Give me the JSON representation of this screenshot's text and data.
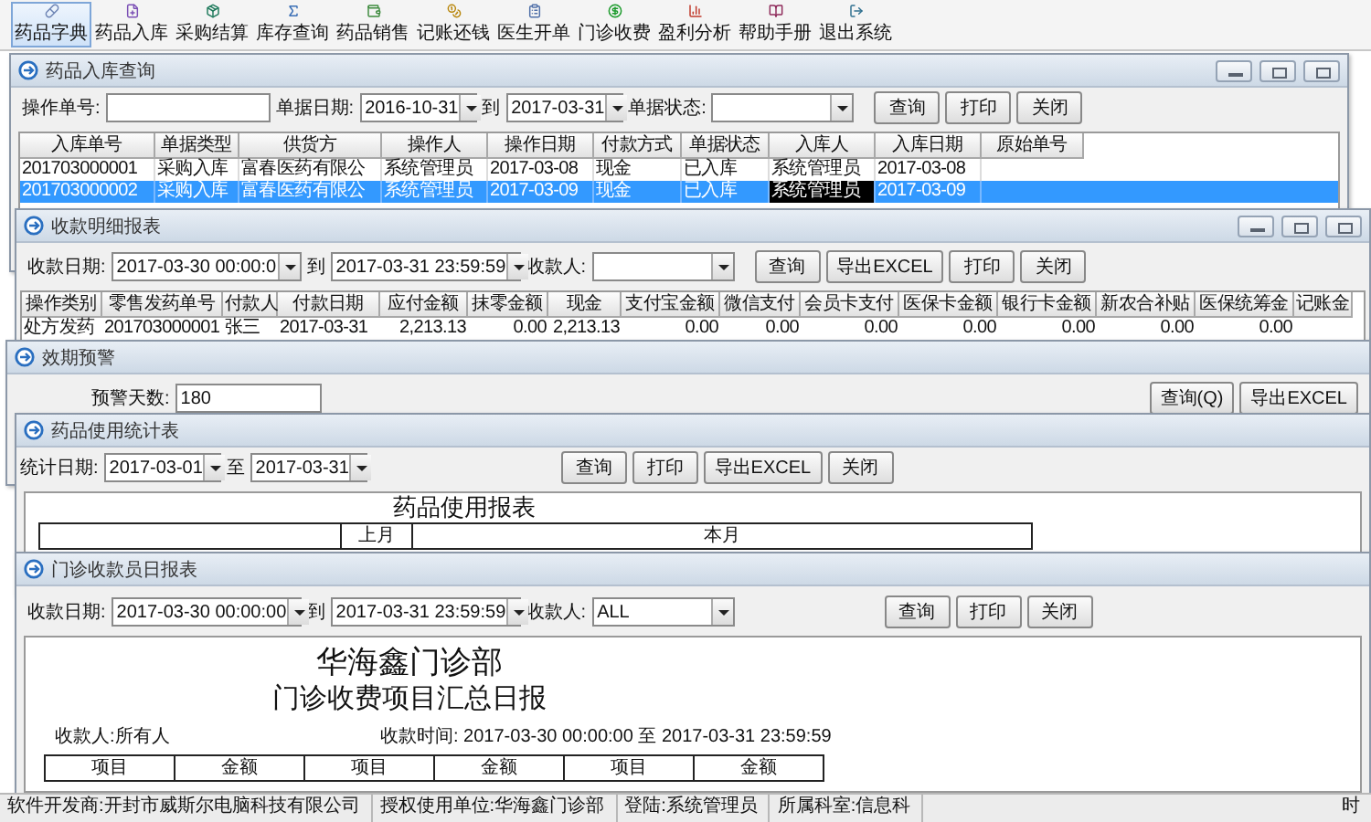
{
  "toolbar": [
    {
      "label": "药品字典",
      "selected": true
    },
    {
      "label": "药品入库",
      "selected": false
    },
    {
      "label": "采购结算",
      "selected": false
    },
    {
      "label": "库存查询",
      "selected": false
    },
    {
      "label": "药品销售",
      "selected": false
    },
    {
      "label": "记账还钱",
      "selected": false
    },
    {
      "label": "医生开单",
      "selected": false
    },
    {
      "label": "门诊收费",
      "selected": false
    },
    {
      "label": "盈利分析",
      "selected": false
    },
    {
      "label": "帮助手册",
      "selected": false
    },
    {
      "label": "退出系统",
      "selected": false
    }
  ],
  "windows": [
    {
      "title": "药品入库查询",
      "caption_buttons": true,
      "controls": [
        {
          "kind": "label",
          "text": "操作单号:"
        },
        {
          "kind": "field"
        },
        {
          "kind": "label",
          "text": "单据日期:"
        },
        {
          "kind": "date",
          "value": "2016-10-31"
        },
        {
          "kind": "label",
          "text": "到"
        },
        {
          "kind": "date",
          "value": "2017-03-31"
        },
        {
          "kind": "label",
          "text": "单据状态:"
        },
        {
          "kind": "combo"
        },
        {
          "kind": "button",
          "text": "查询"
        },
        {
          "kind": "button",
          "text": "打印"
        },
        {
          "kind": "button",
          "text": "关闭"
        }
      ],
      "table": {
        "columns": [
          "入库单号",
          "单据类型",
          "供货方",
          "操作人",
          "操作日期",
          "付款方式",
          "单据状态",
          "入库人",
          "入库日期",
          "原始单号"
        ],
        "rows": [
          {
            "selected": false,
            "cells": [
              {
                "text": "201703000001",
                "focused": false
              },
              {
                "text": "采购入库",
                "focused": false
              },
              {
                "text": "富春医药有限公",
                "focused": false
              },
              {
                "text": "系统管理员",
                "focused": false
              },
              {
                "text": "2017-03-08",
                "focused": false
              },
              {
                "text": "现金",
                "focused": false
              },
              {
                "text": "已入库",
                "focused": false
              },
              {
                "text": "系统管理员",
                "focused": false
              },
              {
                "text": "2017-03-08",
                "focused": false
              }
            ]
          },
          {
            "selected": true,
            "cells": [
              {
                "text": "201703000002",
                "focused": false
              },
              {
                "text": "采购入库",
                "focused": false
              },
              {
                "text": "富春医药有限公",
                "focused": false
              },
              {
                "text": "系统管理员",
                "focused": false
              },
              {
                "text": "2017-03-09",
                "focused": false
              },
              {
                "text": "现金",
                "focused": false
              },
              {
                "text": "已入库",
                "focused": false
              },
              {
                "text": "系统管理员",
                "focused": true
              },
              {
                "text": "2017-03-09",
                "focused": false
              }
            ]
          }
        ]
      }
    },
    {
      "title": "收款明细报表",
      "caption_buttons": true,
      "controls": [
        {
          "kind": "label",
          "text": "收款日期:"
        },
        {
          "kind": "date",
          "value": "2017-03-30 00:00:0"
        },
        {
          "kind": "label",
          "text": "到"
        },
        {
          "kind": "date",
          "value": "2017-03-31 23:59:59"
        },
        {
          "kind": "label",
          "text": "收款人:"
        },
        {
          "kind": "combo"
        },
        {
          "kind": "button",
          "text": "查询"
        },
        {
          "kind": "button",
          "text": "导出EXCEL"
        },
        {
          "kind": "button",
          "text": "打印"
        },
        {
          "kind": "button",
          "text": "关闭"
        }
      ],
      "table": {
        "columns": [
          "操作类别",
          "零售发药单号",
          "付款人",
          "付款日期",
          "应付金额",
          "抹零金额",
          "现金",
          "支付宝金额",
          "微信支付",
          "会员卡支付",
          "医保卡金额",
          "银行卡金额",
          "新农合补贴",
          "医保统筹金",
          "记账金"
        ],
        "rows": [
          {
            "selected": false,
            "cells": [
              {
                "text": "处方发药",
                "focused": false
              },
              {
                "text": "201703000001",
                "focused": false
              },
              {
                "text": "张三",
                "focused": false
              },
              {
                "text": "2017-03-31",
                "focused": false
              },
              {
                "text": "2,213.13",
                "focused": false
              },
              {
                "text": "0.00",
                "focused": false
              },
              {
                "text": "2,213.13",
                "focused": false
              },
              {
                "text": "0.00",
                "focused": false
              },
              {
                "text": "0.00",
                "focused": false
              },
              {
                "text": "0.00",
                "focused": false
              },
              {
                "text": "0.00",
                "focused": false
              },
              {
                "text": "0.00",
                "focused": false
              },
              {
                "text": "0.00",
                "focused": false
              },
              {
                "text": "0.00",
                "focused": false
              }
            ]
          }
        ]
      }
    },
    {
      "title": "效期预警",
      "caption_buttons": false,
      "controls": [
        {
          "kind": "label",
          "text": "预警天数:"
        },
        {
          "kind": "field",
          "value": "180"
        },
        {
          "kind": "button",
          "text": "查询(Q)"
        },
        {
          "kind": "button",
          "text": "导出EXCEL"
        }
      ]
    },
    {
      "title": "药品使用统计表",
      "caption_buttons": false,
      "controls": [
        {
          "kind": "label",
          "text": "统计日期:"
        },
        {
          "kind": "date",
          "value": "2017-03-01"
        },
        {
          "kind": "label",
          "text": "至"
        },
        {
          "kind": "date",
          "value": "2017-03-31"
        },
        {
          "kind": "button",
          "text": "查询"
        },
        {
          "kind": "button",
          "text": "打印"
        },
        {
          "kind": "button",
          "text": "导出EXCEL"
        },
        {
          "kind": "button",
          "text": "关闭"
        }
      ],
      "report": {
        "kind": "usage",
        "title": "药品使用报表",
        "header_cells": [
          "上月",
          "本月"
        ]
      }
    },
    {
      "title": "门诊收款员日报表",
      "caption_buttons": false,
      "controls": [
        {
          "kind": "label",
          "text": "收款日期:"
        },
        {
          "kind": "date",
          "value": "2017-03-30 00:00:00"
        },
        {
          "kind": "label",
          "text": "到"
        },
        {
          "kind": "date",
          "value": "2017-03-31 23:59:59"
        },
        {
          "kind": "label",
          "text": "收款人:"
        },
        {
          "kind": "combo",
          "value": "ALL"
        },
        {
          "kind": "button",
          "text": "查询"
        },
        {
          "kind": "button",
          "text": "打印"
        },
        {
          "kind": "button",
          "text": "关闭"
        }
      ],
      "report": {
        "kind": "daily",
        "title": "华海鑫门诊部",
        "subtitle": "门诊收费项目汇总日报",
        "info_left": "收款人:所有人",
        "info_right": "收款时间: 2017-03-30 00:00:00 至 2017-03-31 23:59:59",
        "header_cells": [
          "项目",
          "金额",
          "项目",
          "金额",
          "项目",
          "金额"
        ]
      }
    }
  ],
  "status_bar": [
    "软件开发商:开封市威斯尔电脑科技有限公司",
    "授权使用单位:华海鑫门诊部",
    "登陆:系统管理员",
    "所属科室:信息科",
    "时"
  ]
}
